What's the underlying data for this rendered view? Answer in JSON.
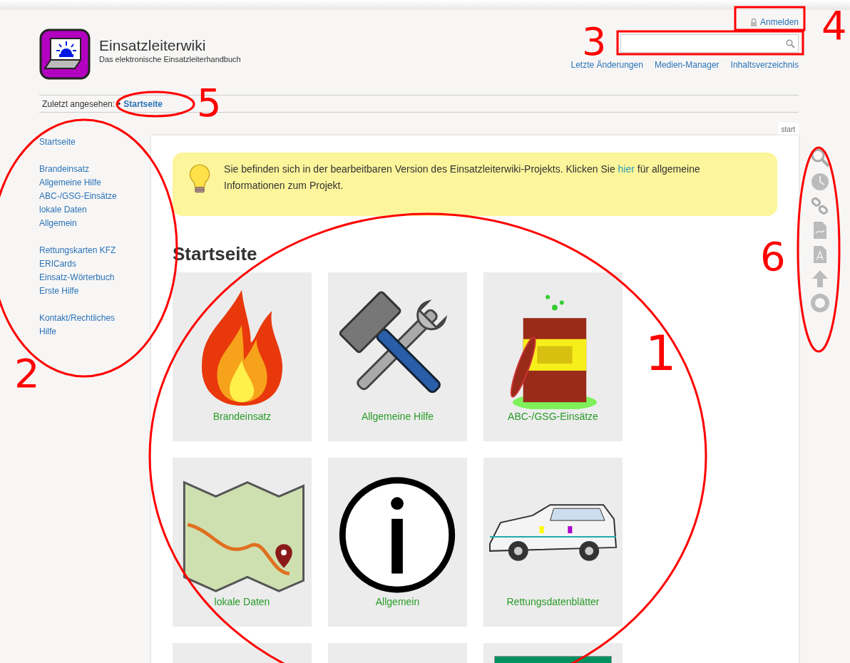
{
  "header": {
    "title": "Einsatzleiterwiki",
    "tagline": "Das elektronische Einsatzleiterhandbuch",
    "login": "Anmelden",
    "links": [
      "Letzte Änderungen",
      "Medien-Manager",
      "Inhaltsverzeichnis"
    ]
  },
  "breadcrumb": {
    "label": "Zuletzt angesehen:",
    "separator": "•",
    "items": [
      "Startseite"
    ]
  },
  "sidebar": {
    "groups": [
      {
        "items": [
          "Startseite"
        ]
      },
      {
        "items": [
          "Brandeinsatz",
          "Allgemeine Hilfe",
          "ABC-/GSG-Einsätze",
          "lokale Daten",
          "Allgemein"
        ]
      },
      {
        "items": [
          "Rettungskarten KFZ",
          "ERICards",
          "Einsatz-Wörterbuch",
          "Erste Hilfe"
        ]
      },
      {
        "items": [
          "Kontakt/Rechtliches",
          "Hilfe"
        ]
      }
    ]
  },
  "page": {
    "tab": "start",
    "notice": {
      "before": "Sie befinden sich in der bearbeitbaren Version des Einsatzleiterwiki-Projekts. Klicken Sie ",
      "link": "hier",
      "after": " für allgemeine Informationen zum Projekt."
    },
    "heading": "Startseite",
    "tiles": [
      {
        "kind": "flame",
        "label": "Brandeinsatz"
      },
      {
        "kind": "tools",
        "label": "Allgemeine Hilfe"
      },
      {
        "kind": "barrel",
        "label": "ABC-/GSG-Einsätze"
      },
      {
        "kind": "map",
        "label": "lokale Daten"
      },
      {
        "kind": "info",
        "label": "Allgemein"
      },
      {
        "kind": "car",
        "label": "Rettungsdatenblätter"
      },
      {
        "kind": "blank"
      },
      {
        "kind": "blank"
      },
      {
        "kind": "sign"
      }
    ]
  },
  "annotations": [
    {
      "label": "1"
    },
    {
      "label": "2"
    },
    {
      "label": "3"
    },
    {
      "label": "4"
    },
    {
      "label": "5"
    },
    {
      "label": "6"
    }
  ]
}
